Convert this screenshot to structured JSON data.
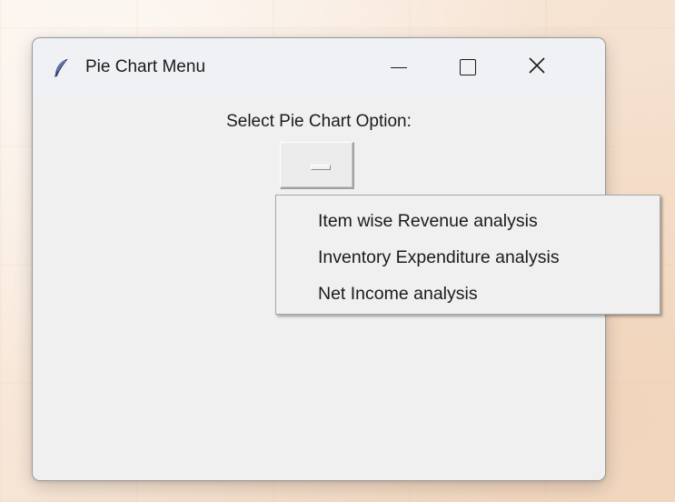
{
  "window": {
    "title": "Pie Chart Menu",
    "icon": "feather-icon"
  },
  "titlebar_buttons": {
    "minimize": "minimize-icon",
    "maximize": "maximize-icon",
    "close": "close-icon"
  },
  "content": {
    "prompt_label": "Select Pie Chart Option:",
    "option_menu_value": ""
  },
  "dropdown": {
    "items": [
      {
        "label": "Item wise Revenue analysis"
      },
      {
        "label": "Inventory Expenditure analysis"
      },
      {
        "label": "Net Income analysis"
      }
    ]
  },
  "colors": {
    "window_bg": "#f0f0f0",
    "titlebar_bg": "#eff1f4",
    "text": "#1b1b1b"
  }
}
